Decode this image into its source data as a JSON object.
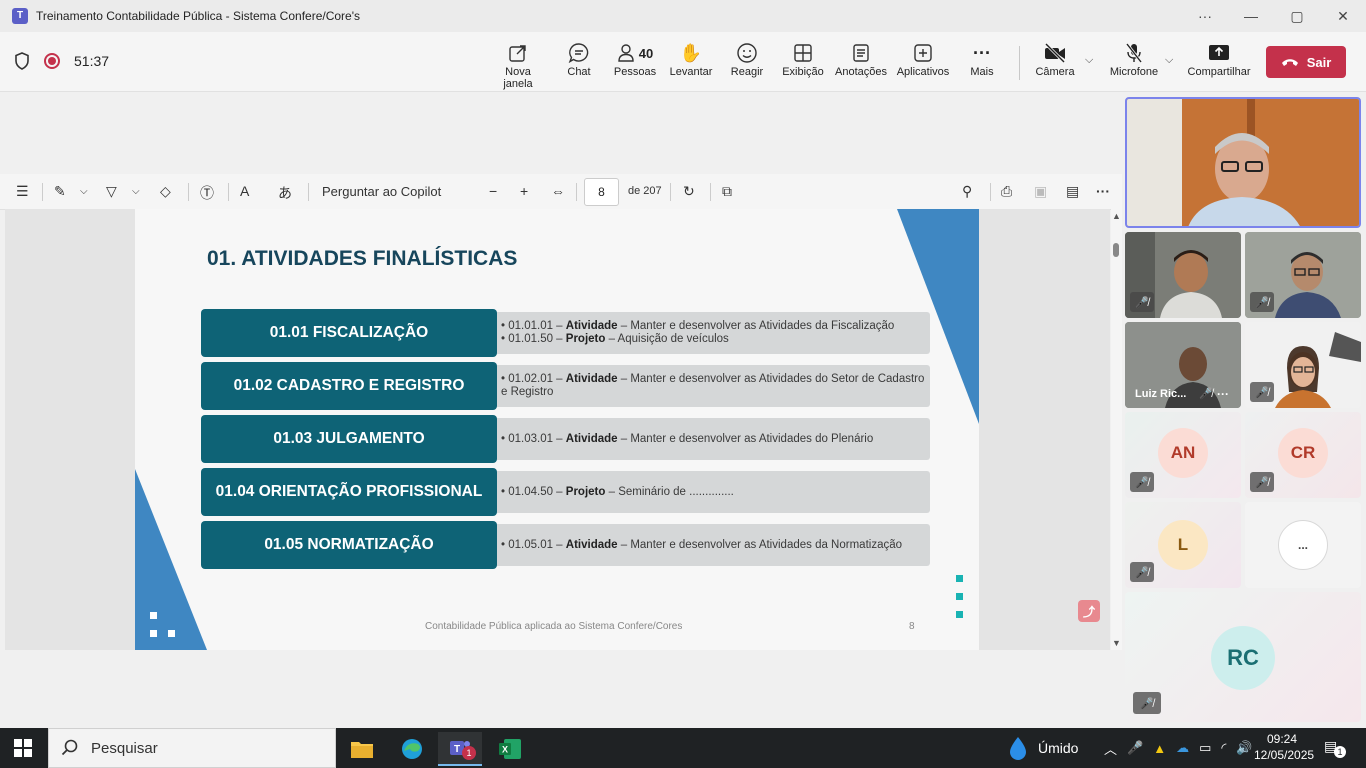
{
  "window": {
    "title": "Treinamento Contabilidade Pública - Sistema Confere/Core's",
    "app_icon": "teams-icon",
    "controls": [
      "···",
      "—",
      "▢",
      "✕"
    ]
  },
  "meeting": {
    "timer": "51:37",
    "people_count": "40",
    "tools": [
      {
        "label": "Nova janela",
        "icon": "popout-icon",
        "glyph": "⧉"
      },
      {
        "label": "Chat",
        "icon": "chat-icon",
        "glyph": "💬"
      },
      {
        "label": "Pessoas",
        "icon": "people-icon",
        "glyph": "👤"
      },
      {
        "label": "Levantar",
        "icon": "raise-hand-icon",
        "glyph": "✋"
      },
      {
        "label": "Reagir",
        "icon": "react-icon",
        "glyph": "☺"
      },
      {
        "label": "Exibição",
        "icon": "view-icon",
        "glyph": "⊞"
      },
      {
        "label": "Anotações",
        "icon": "notes-icon",
        "glyph": "▤"
      },
      {
        "label": "Aplicativos",
        "icon": "apps-icon",
        "glyph": "⊕"
      },
      {
        "label": "Mais",
        "icon": "more-icon",
        "glyph": "···"
      }
    ],
    "camera_label": "Câmera",
    "mic_label": "Microfone",
    "share_label": "Compartilhar",
    "leave_label": "Sair"
  },
  "pdf_toolbar": {
    "copilot_label": "Perguntar ao Copilot",
    "page_current": "8",
    "page_total": "de 207"
  },
  "slide": {
    "title": "01. ATIVIDADES FINALÍSTICAS",
    "rows": [
      {
        "heading": "01.01 FISCALIZAÇÃO",
        "items": [
          {
            "code": "• 01.01.01 – ",
            "kind": "Atividade",
            "text": " – Manter e desenvolver as Atividades da Fiscalização"
          },
          {
            "code": "• 01.01.50 – ",
            "kind": "Projeto",
            "text": " – Aquisição de veículos"
          }
        ]
      },
      {
        "heading": "01.02 CADASTRO E REGISTRO",
        "items": [
          {
            "code": "• 01.02.01 – ",
            "kind": "Atividade",
            "text": " – Manter e desenvolver as Atividades do Setor de Cadastro e Registro"
          }
        ]
      },
      {
        "heading": "01.03 JULGAMENTO",
        "items": [
          {
            "code": "• 01.03.01 – ",
            "kind": "Atividade",
            "text": " – Manter e desenvolver as Atividades do Plenário"
          }
        ]
      },
      {
        "heading": "01.04 ORIENTAÇÃO PROFISSIONAL",
        "items": [
          {
            "code": "• 01.04.50 – ",
            "kind": "Projeto",
            "text": " – Seminário de .............."
          }
        ]
      },
      {
        "heading": "01.05 NORMATIZAÇÃO",
        "items": [
          {
            "code": "• 01.05.01 – ",
            "kind": "Atividade",
            "text": " – Manter e desenvolver as Atividades da Normatização"
          }
        ]
      }
    ],
    "footer": "Contabilidade Pública aplicada ao Sistema Confere/Cores",
    "page_number": "8"
  },
  "participants": {
    "luiz_label": "Luiz Ric...",
    "an": "AN",
    "cr": "CR",
    "l": "L",
    "more": "...",
    "rc": "RC"
  },
  "taskbar": {
    "search_placeholder": "Pesquisar",
    "weather": "Úmido",
    "time": "09:24",
    "date": "12/05/2025",
    "notification_count": "1",
    "teams_badge": "1"
  },
  "colors": {
    "slide_box": "#0e6376",
    "slide_title": "#17465c",
    "accent_blue": "#3f87c2",
    "leave_red": "#c4314b",
    "teal_square": "#19b3b3"
  }
}
